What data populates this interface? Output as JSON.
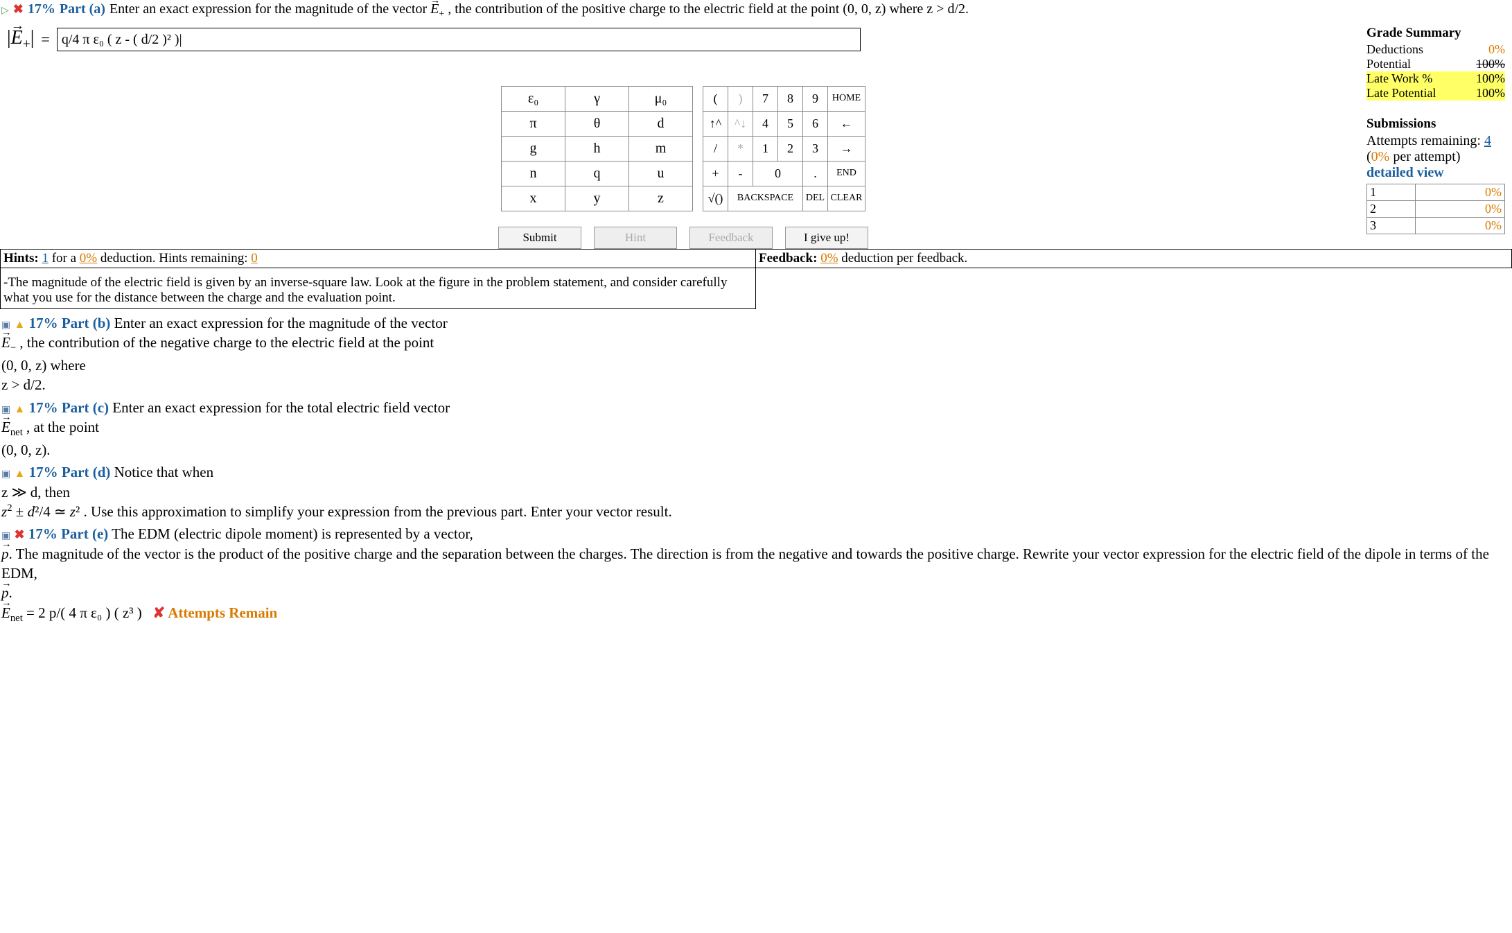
{
  "parts": {
    "a": {
      "pct": "17%",
      "label": "Part (a)",
      "prompt": "Enter an exact expression for the magnitude of the vector",
      "vec_sym": "E",
      "vec_sub": "+",
      "prompt2": ", the contribution of the positive charge to the electric field at the point (0, 0, z) where z > d/2.",
      "answer_vec": "E",
      "answer_vec_sub": "+",
      "answer_expr": "q/4 π ε₀ ( z - ( d/2 )² )|"
    },
    "b": {
      "pct": "17%",
      "label": "Part (b)",
      "line1": "Enter an exact expression for the magnitude of the vector",
      "vec_sym": "E",
      "vec_sub": "−",
      "line2": ", the contribution of the negative charge to the electric field at the point",
      "line3": "(0, 0, z) where",
      "line4": "z > d/2."
    },
    "c": {
      "pct": "17%",
      "label": "Part (c)",
      "line1": "Enter an exact expression for the total electric field vector",
      "vec_sym": "E",
      "vec_sub": "net",
      "line2": ", at the point",
      "line3": "(0, 0, z)."
    },
    "d": {
      "pct": "17%",
      "label": "Part (d)",
      "line1": "Notice that when",
      "line2": "z ≫ d, then",
      "line3_pre": "z",
      "line3_mid": " ± d²/4 ≃ z² . Use this approximation to simplify your expression from the previous part. Enter your vector result."
    },
    "e": {
      "pct": "17%",
      "label": "Part (e)",
      "line1": "The EDM (electric dipole moment) is represented by a vector,",
      "vec_sym": "p",
      "line2": ". The magnitude of the vector is the product of the positive charge and the separation between the charges. The direction is from the negative and towards the positive charge. Rewrite your vector expression for the electric field of the dipole in terms of the EDM,",
      "answer_vec": "E",
      "answer_vec_sub": "net",
      "answer_expr": " = 2 p/( 4 π ε₀ ) ( z³ )",
      "attempts_remain": "✘ Attempts Remain"
    }
  },
  "keypad": {
    "symbols": [
      [
        "ε₀",
        "γ",
        "μ₀"
      ],
      [
        "π",
        "θ",
        "d"
      ],
      [
        "g",
        "h",
        "m"
      ],
      [
        "n",
        "q",
        "u"
      ],
      [
        "x",
        "y",
        "z"
      ]
    ],
    "numrows": [
      [
        "(",
        ")",
        "7",
        "8",
        "9",
        "HOME"
      ],
      [
        "↑^",
        "^↓",
        "4",
        "5",
        "6",
        "←"
      ],
      [
        "/",
        "*",
        "1",
        "2",
        "3",
        "→"
      ],
      [
        "+",
        "-",
        "0",
        ".",
        "END"
      ],
      [
        "√()",
        "BACKSPACE",
        "DEL",
        "CLEAR"
      ]
    ]
  },
  "actions": {
    "submit": "Submit",
    "hint": "Hint",
    "feedback": "Feedback",
    "giveup": "I give up!"
  },
  "summary": {
    "title": "Grade Summary",
    "deductions_label": "Deductions",
    "deductions_val": "0%",
    "potential_label": "Potential",
    "potential_val": "100%",
    "latework_label": "Late Work %",
    "latework_val": "100%",
    "latepot_label": "Late Potential",
    "latepot_val": "100%",
    "submissions_title": "Submissions",
    "attempts_label": "Attempts remaining:",
    "attempts_val": "4",
    "per_attempt": "(0% per attempt)",
    "detailed_view": "detailed view",
    "rows": [
      {
        "n": "1",
        "v": "0%"
      },
      {
        "n": "2",
        "v": "0%"
      },
      {
        "n": "3",
        "v": "0%"
      }
    ]
  },
  "hints": {
    "label": "Hints:",
    "count": "1",
    "for_a": " for a ",
    "ded_pct": "0%",
    "ded_txt": " deduction. Hints remaining: ",
    "remaining": "0",
    "body": "-The magnitude of the electric field is given by an inverse-square law. Look at the figure in the problem statement, and consider carefully what you use for the distance between the charge and the evaluation point."
  },
  "feedback": {
    "label": "Feedback:",
    "pct": "0%",
    "txt": " deduction per feedback."
  }
}
